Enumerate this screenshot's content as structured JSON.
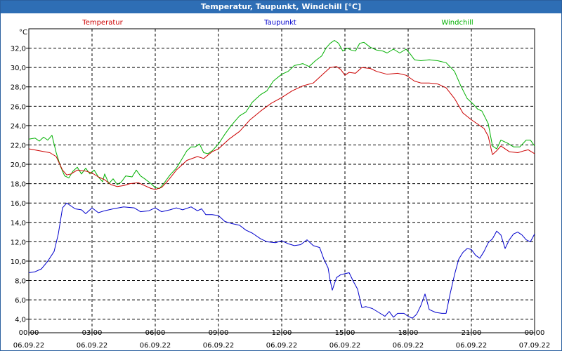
{
  "window": {
    "title": "Temperatur, Taupunkt, Windchill [°C]"
  },
  "colors": {
    "title_bar": "#2e6eb5",
    "temperatur": "#cc0000",
    "taupunkt": "#0000cc",
    "windchill": "#00b000"
  },
  "chart_data": {
    "type": "line",
    "title": "Temperatur, Taupunkt, Windchill [°C]",
    "ylabel": "°C",
    "xlabel": "",
    "ylim": [
      2.6,
      34.0
    ],
    "xlim": [
      0,
      24
    ],
    "grid": true,
    "legend_placement": "top",
    "y_ticks": [
      "32,0",
      "30,0",
      "28,0",
      "26,0",
      "24,0",
      "22,0",
      "20,0",
      "18,0",
      "16,0",
      "14,0",
      "12,0",
      "10,0",
      "8,0",
      "6,0",
      "4,0"
    ],
    "x_ticks": [
      {
        "time": "00:00",
        "date": "06.09.22"
      },
      {
        "time": "03:00",
        "date": "06.09.22"
      },
      {
        "time": "06:00",
        "date": "06.09.22"
      },
      {
        "time": "09:00",
        "date": "06.09.22"
      },
      {
        "time": "12:00",
        "date": "06.09.22"
      },
      {
        "time": "15:00",
        "date": "06.09.22"
      },
      {
        "time": "18:00",
        "date": "06.09.22"
      },
      {
        "time": "21:00",
        "date": "06.09.22"
      },
      {
        "time": "00:00",
        "date": "07.09.22"
      }
    ],
    "series": [
      {
        "name": "Temperatur",
        "color": "#cc0000",
        "points": [
          [
            0,
            21.6
          ],
          [
            0.5,
            21.4
          ],
          [
            1,
            21.2
          ],
          [
            1.3,
            20.8
          ],
          [
            1.6,
            19.4
          ],
          [
            1.8,
            18.9
          ],
          [
            2,
            19.0
          ],
          [
            2.3,
            19.4
          ],
          [
            2.7,
            19.3
          ],
          [
            3,
            19.1
          ],
          [
            3.3,
            18.7
          ],
          [
            3.6,
            18.4
          ],
          [
            3.9,
            17.9
          ],
          [
            4.2,
            17.7
          ],
          [
            4.5,
            17.8
          ],
          [
            4.8,
            18.0
          ],
          [
            5.2,
            18.1
          ],
          [
            5.5,
            17.8
          ],
          [
            5.8,
            17.5
          ],
          [
            6,
            17.4
          ],
          [
            6.3,
            17.6
          ],
          [
            6.6,
            18.3
          ],
          [
            7,
            19.4
          ],
          [
            7.5,
            20.4
          ],
          [
            8,
            20.8
          ],
          [
            8.3,
            20.6
          ],
          [
            8.7,
            21.3
          ],
          [
            9,
            21.6
          ],
          [
            9.5,
            22.6
          ],
          [
            10,
            23.4
          ],
          [
            10.5,
            24.6
          ],
          [
            11,
            25.5
          ],
          [
            11.5,
            26.3
          ],
          [
            12,
            26.9
          ],
          [
            12.5,
            27.6
          ],
          [
            13,
            28.1
          ],
          [
            13.5,
            28.4
          ],
          [
            14,
            29.4
          ],
          [
            14.3,
            30.0
          ],
          [
            14.6,
            30.1
          ],
          [
            14.8,
            29.8
          ],
          [
            15,
            29.2
          ],
          [
            15.2,
            29.5
          ],
          [
            15.5,
            29.4
          ],
          [
            15.8,
            30.0
          ],
          [
            16.2,
            29.9
          ],
          [
            16.5,
            29.6
          ],
          [
            17,
            29.3
          ],
          [
            17.5,
            29.4
          ],
          [
            17.9,
            29.2
          ],
          [
            18.3,
            28.6
          ],
          [
            18.6,
            28.4
          ],
          [
            19,
            28.4
          ],
          [
            19.4,
            28.3
          ],
          [
            19.8,
            27.9
          ],
          [
            20.2,
            26.8
          ],
          [
            20.6,
            25.3
          ],
          [
            21,
            24.6
          ],
          [
            21.4,
            24.0
          ],
          [
            21.6,
            23.7
          ],
          [
            21.8,
            22.9
          ],
          [
            22,
            21.0
          ],
          [
            22.2,
            21.4
          ],
          [
            22.4,
            21.9
          ],
          [
            22.8,
            21.3
          ],
          [
            23.2,
            21.2
          ],
          [
            23.5,
            21.4
          ],
          [
            23.7,
            21.5
          ],
          [
            24,
            21.1
          ]
        ]
      },
      {
        "name": "Taupunkt",
        "color": "#0000cc",
        "points": [
          [
            0,
            8.8
          ],
          [
            0.3,
            8.9
          ],
          [
            0.6,
            9.2
          ],
          [
            0.9,
            10.0
          ],
          [
            1.2,
            11.0
          ],
          [
            1.4,
            12.8
          ],
          [
            1.6,
            15.5
          ],
          [
            1.8,
            16.0
          ],
          [
            2,
            15.7
          ],
          [
            2.2,
            15.4
          ],
          [
            2.5,
            15.3
          ],
          [
            2.7,
            14.9
          ],
          [
            3,
            15.5
          ],
          [
            3.3,
            15.0
          ],
          [
            3.6,
            15.2
          ],
          [
            4,
            15.4
          ],
          [
            4.5,
            15.6
          ],
          [
            5,
            15.5
          ],
          [
            5.3,
            15.1
          ],
          [
            5.7,
            15.2
          ],
          [
            6,
            15.5
          ],
          [
            6.3,
            15.1
          ],
          [
            6.7,
            15.3
          ],
          [
            7,
            15.5
          ],
          [
            7.3,
            15.3
          ],
          [
            7.7,
            15.6
          ],
          [
            8,
            15.2
          ],
          [
            8.2,
            15.4
          ],
          [
            8.4,
            14.8
          ],
          [
            8.7,
            14.8
          ],
          [
            9,
            14.7
          ],
          [
            9.3,
            14.1
          ],
          [
            9.6,
            13.9
          ],
          [
            10,
            13.7
          ],
          [
            10.3,
            13.2
          ],
          [
            10.6,
            12.9
          ],
          [
            11,
            12.3
          ],
          [
            11.3,
            12.0
          ],
          [
            11.7,
            11.9
          ],
          [
            12,
            12.1
          ],
          [
            12.3,
            11.8
          ],
          [
            12.6,
            11.6
          ],
          [
            12.9,
            11.7
          ],
          [
            13.2,
            12.2
          ],
          [
            13.5,
            11.6
          ],
          [
            13.8,
            11.4
          ],
          [
            14,
            10.2
          ],
          [
            14.2,
            9.3
          ],
          [
            14.3,
            8.0
          ],
          [
            14.4,
            7.0
          ],
          [
            14.6,
            8.3
          ],
          [
            14.8,
            8.6
          ],
          [
            15,
            8.7
          ],
          [
            15.2,
            8.8
          ],
          [
            15.4,
            7.9
          ],
          [
            15.6,
            7.1
          ],
          [
            15.8,
            5.2
          ],
          [
            16,
            5.3
          ],
          [
            16.3,
            5.1
          ],
          [
            16.6,
            4.7
          ],
          [
            16.9,
            4.3
          ],
          [
            17.1,
            4.8
          ],
          [
            17.3,
            4.2
          ],
          [
            17.5,
            4.6
          ],
          [
            17.8,
            4.6
          ],
          [
            18,
            4.3
          ],
          [
            18.2,
            4.1
          ],
          [
            18.4,
            4.5
          ],
          [
            18.6,
            5.4
          ],
          [
            18.8,
            6.6
          ],
          [
            19,
            5.0
          ],
          [
            19.3,
            4.7
          ],
          [
            19.6,
            4.6
          ],
          [
            19.8,
            4.6
          ],
          [
            20,
            6.7
          ],
          [
            20.2,
            8.6
          ],
          [
            20.4,
            10.2
          ],
          [
            20.6,
            10.9
          ],
          [
            20.8,
            11.3
          ],
          [
            21,
            11.2
          ],
          [
            21.2,
            10.6
          ],
          [
            21.4,
            10.3
          ],
          [
            21.6,
            11.0
          ],
          [
            21.8,
            11.9
          ],
          [
            22,
            12.3
          ],
          [
            22.2,
            13.1
          ],
          [
            22.4,
            12.7
          ],
          [
            22.6,
            11.3
          ],
          [
            22.8,
            12.2
          ],
          [
            23,
            12.8
          ],
          [
            23.2,
            13.0
          ],
          [
            23.4,
            12.7
          ],
          [
            23.6,
            12.2
          ],
          [
            23.8,
            12.0
          ],
          [
            24,
            12.8
          ]
        ]
      },
      {
        "name": "Windchill",
        "color": "#00b000",
        "points": [
          [
            0,
            22.6
          ],
          [
            0.3,
            22.7
          ],
          [
            0.5,
            22.4
          ],
          [
            0.7,
            22.8
          ],
          [
            0.9,
            22.5
          ],
          [
            1.1,
            23.0
          ],
          [
            1.3,
            21.2
          ],
          [
            1.5,
            19.8
          ],
          [
            1.7,
            18.8
          ],
          [
            1.9,
            18.6
          ],
          [
            2.1,
            19.3
          ],
          [
            2.3,
            19.7
          ],
          [
            2.5,
            19.0
          ],
          [
            2.7,
            19.6
          ],
          [
            2.9,
            19.0
          ],
          [
            3.1,
            19.4
          ],
          [
            3.3,
            18.7
          ],
          [
            3.5,
            18.2
          ],
          [
            3.6,
            19.0
          ],
          [
            3.8,
            18.0
          ],
          [
            4,
            18.5
          ],
          [
            4.2,
            17.9
          ],
          [
            4.4,
            18.2
          ],
          [
            4.6,
            18.8
          ],
          [
            4.9,
            18.7
          ],
          [
            5.1,
            19.4
          ],
          [
            5.3,
            18.8
          ],
          [
            5.5,
            18.5
          ],
          [
            5.8,
            18.0
          ],
          [
            6,
            17.6
          ],
          [
            6.2,
            17.5
          ],
          [
            6.4,
            18.0
          ],
          [
            6.7,
            18.9
          ],
          [
            7,
            19.6
          ],
          [
            7.2,
            20.3
          ],
          [
            7.5,
            21.4
          ],
          [
            7.7,
            21.8
          ],
          [
            7.9,
            21.8
          ],
          [
            8.1,
            22.1
          ],
          [
            8.3,
            21.2
          ],
          [
            8.5,
            21.1
          ],
          [
            8.7,
            21.4
          ],
          [
            9,
            22.1
          ],
          [
            9.3,
            23.1
          ],
          [
            9.6,
            24.0
          ],
          [
            10,
            25.0
          ],
          [
            10.3,
            25.4
          ],
          [
            10.6,
            26.4
          ],
          [
            11,
            27.2
          ],
          [
            11.3,
            27.6
          ],
          [
            11.6,
            28.6
          ],
          [
            12,
            29.3
          ],
          [
            12.3,
            29.6
          ],
          [
            12.6,
            30.2
          ],
          [
            13,
            30.4
          ],
          [
            13.3,
            30.1
          ],
          [
            13.6,
            30.7
          ],
          [
            13.9,
            31.2
          ],
          [
            14.1,
            32.0
          ],
          [
            14.3,
            32.5
          ],
          [
            14.5,
            32.8
          ],
          [
            14.7,
            32.5
          ],
          [
            14.9,
            31.7
          ],
          [
            15.1,
            32.0
          ],
          [
            15.3,
            31.8
          ],
          [
            15.5,
            31.7
          ],
          [
            15.7,
            32.5
          ],
          [
            15.9,
            32.6
          ],
          [
            16.2,
            32.1
          ],
          [
            16.5,
            31.8
          ],
          [
            16.8,
            31.7
          ],
          [
            17,
            31.5
          ],
          [
            17.3,
            31.9
          ],
          [
            17.6,
            31.5
          ],
          [
            17.9,
            31.9
          ],
          [
            18.1,
            31.4
          ],
          [
            18.3,
            30.8
          ],
          [
            18.6,
            30.7
          ],
          [
            19,
            30.8
          ],
          [
            19.4,
            30.7
          ],
          [
            19.8,
            30.5
          ],
          [
            20.2,
            29.6
          ],
          [
            20.5,
            28.1
          ],
          [
            20.8,
            26.8
          ],
          [
            21.1,
            26.2
          ],
          [
            21.3,
            25.7
          ],
          [
            21.5,
            25.5
          ],
          [
            21.8,
            24.2
          ],
          [
            22,
            21.9
          ],
          [
            22.2,
            21.6
          ],
          [
            22.4,
            22.5
          ],
          [
            22.7,
            22.2
          ],
          [
            23,
            21.8
          ],
          [
            23.3,
            21.8
          ],
          [
            23.6,
            22.5
          ],
          [
            23.8,
            22.5
          ],
          [
            24,
            21.9
          ]
        ]
      }
    ]
  }
}
